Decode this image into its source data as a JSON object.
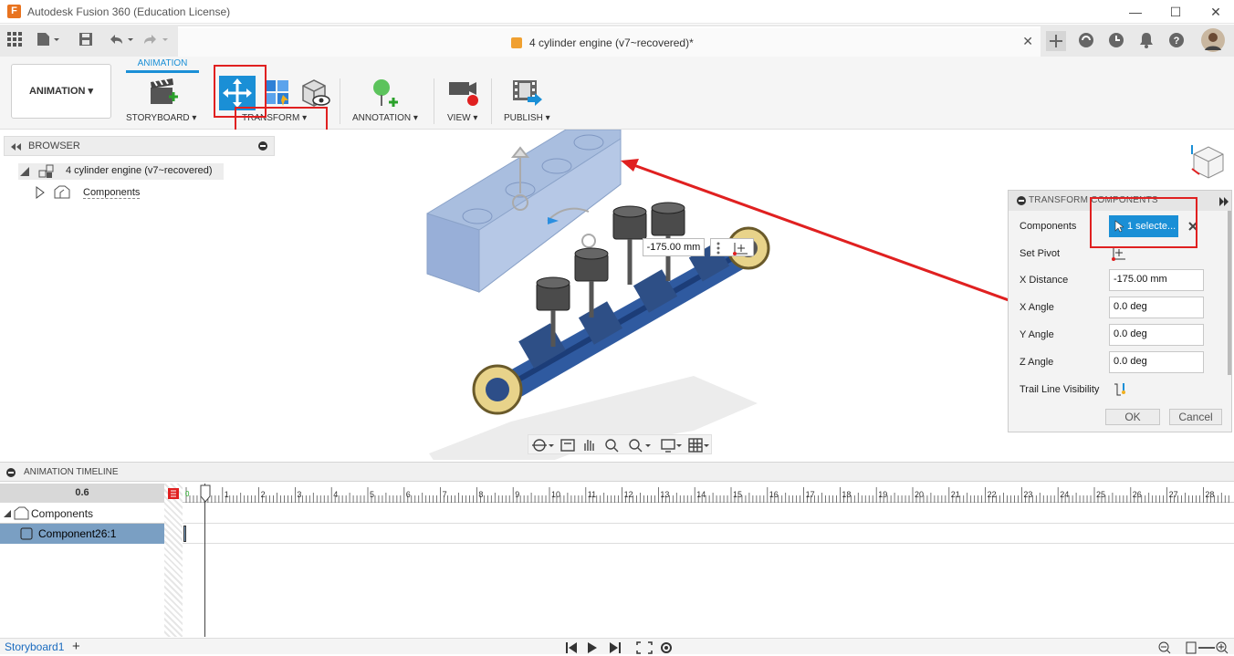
{
  "window": {
    "title": "Autodesk Fusion 360 (Education License)",
    "min": "—",
    "max": "☐",
    "close": "✕"
  },
  "document": {
    "tab_title": "4 cylinder engine (v7~recovered)*",
    "close": "✕"
  },
  "toolbar": {
    "workspace": "ANIMATION ▾",
    "active_tab": "ANIMATION",
    "groups": {
      "storyboard": "STORYBOARD ▾",
      "transform": "TRANSFORM ▾",
      "annotation": "ANNOTATION ▾",
      "view": "VIEW ▾",
      "publish": "PUBLISH ▾"
    }
  },
  "browser": {
    "title": "BROWSER",
    "root": "4 cylinder engine (v7~recovered)",
    "components": "Components"
  },
  "viewport": {
    "distance_tag": "-175.00 mm"
  },
  "transform_panel": {
    "title": "TRANSFORM COMPONENTS",
    "components_label": "Components",
    "selection": "1 selecte...",
    "set_pivot_label": "Set Pivot",
    "x_distance_label": "X Distance",
    "x_distance_value": "-175.00 mm",
    "x_angle_label": "X Angle",
    "x_angle_value": "0.0 deg",
    "y_angle_label": "Y Angle",
    "y_angle_value": "0.0 deg",
    "z_angle_label": "Z Angle",
    "z_angle_value": "0.0 deg",
    "trail_label": "Trail Line Visibility",
    "ok": "OK",
    "cancel": "Cancel"
  },
  "timeline": {
    "title": "ANIMATION TIMELINE",
    "zoom": "0.6",
    "ruler_start": "0",
    "ruler_labels": [
      "1",
      "2",
      "3",
      "4",
      "5",
      "6",
      "7",
      "8",
      "9",
      "10",
      "11",
      "12",
      "13",
      "14",
      "15",
      "16",
      "17",
      "18",
      "19",
      "20",
      "21",
      "22",
      "23",
      "24",
      "25",
      "26",
      "27",
      "28"
    ],
    "rows": [
      "Components",
      "Component26:1"
    ]
  },
  "status": {
    "storyboard": "Storyboard1",
    "add": "+"
  },
  "colors": {
    "accent": "#1a8fd6",
    "highlight": "#e02020",
    "selected_row": "#7a9fc3"
  }
}
